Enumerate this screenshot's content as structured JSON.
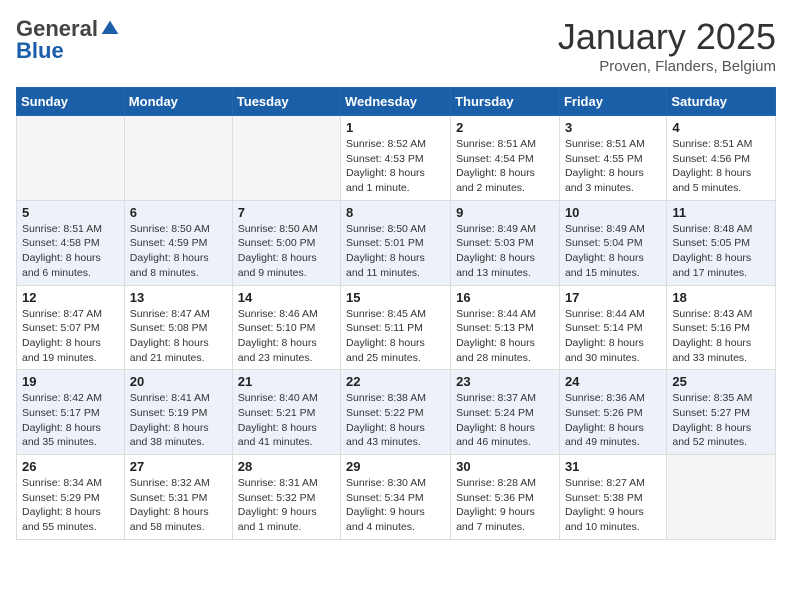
{
  "logo": {
    "general": "General",
    "blue": "Blue"
  },
  "title": {
    "month": "January 2025",
    "location": "Proven, Flanders, Belgium"
  },
  "weekdays": [
    "Sunday",
    "Monday",
    "Tuesday",
    "Wednesday",
    "Thursday",
    "Friday",
    "Saturday"
  ],
  "weeks": [
    [
      {
        "day": "",
        "content": ""
      },
      {
        "day": "",
        "content": ""
      },
      {
        "day": "",
        "content": ""
      },
      {
        "day": "1",
        "content": "Sunrise: 8:52 AM\nSunset: 4:53 PM\nDaylight: 8 hours and 1 minute."
      },
      {
        "day": "2",
        "content": "Sunrise: 8:51 AM\nSunset: 4:54 PM\nDaylight: 8 hours and 2 minutes."
      },
      {
        "day": "3",
        "content": "Sunrise: 8:51 AM\nSunset: 4:55 PM\nDaylight: 8 hours and 3 minutes."
      },
      {
        "day": "4",
        "content": "Sunrise: 8:51 AM\nSunset: 4:56 PM\nDaylight: 8 hours and 5 minutes."
      }
    ],
    [
      {
        "day": "5",
        "content": "Sunrise: 8:51 AM\nSunset: 4:58 PM\nDaylight: 8 hours and 6 minutes."
      },
      {
        "day": "6",
        "content": "Sunrise: 8:50 AM\nSunset: 4:59 PM\nDaylight: 8 hours and 8 minutes."
      },
      {
        "day": "7",
        "content": "Sunrise: 8:50 AM\nSunset: 5:00 PM\nDaylight: 8 hours and 9 minutes."
      },
      {
        "day": "8",
        "content": "Sunrise: 8:50 AM\nSunset: 5:01 PM\nDaylight: 8 hours and 11 minutes."
      },
      {
        "day": "9",
        "content": "Sunrise: 8:49 AM\nSunset: 5:03 PM\nDaylight: 8 hours and 13 minutes."
      },
      {
        "day": "10",
        "content": "Sunrise: 8:49 AM\nSunset: 5:04 PM\nDaylight: 8 hours and 15 minutes."
      },
      {
        "day": "11",
        "content": "Sunrise: 8:48 AM\nSunset: 5:05 PM\nDaylight: 8 hours and 17 minutes."
      }
    ],
    [
      {
        "day": "12",
        "content": "Sunrise: 8:47 AM\nSunset: 5:07 PM\nDaylight: 8 hours and 19 minutes."
      },
      {
        "day": "13",
        "content": "Sunrise: 8:47 AM\nSunset: 5:08 PM\nDaylight: 8 hours and 21 minutes."
      },
      {
        "day": "14",
        "content": "Sunrise: 8:46 AM\nSunset: 5:10 PM\nDaylight: 8 hours and 23 minutes."
      },
      {
        "day": "15",
        "content": "Sunrise: 8:45 AM\nSunset: 5:11 PM\nDaylight: 8 hours and 25 minutes."
      },
      {
        "day": "16",
        "content": "Sunrise: 8:44 AM\nSunset: 5:13 PM\nDaylight: 8 hours and 28 minutes."
      },
      {
        "day": "17",
        "content": "Sunrise: 8:44 AM\nSunset: 5:14 PM\nDaylight: 8 hours and 30 minutes."
      },
      {
        "day": "18",
        "content": "Sunrise: 8:43 AM\nSunset: 5:16 PM\nDaylight: 8 hours and 33 minutes."
      }
    ],
    [
      {
        "day": "19",
        "content": "Sunrise: 8:42 AM\nSunset: 5:17 PM\nDaylight: 8 hours and 35 minutes."
      },
      {
        "day": "20",
        "content": "Sunrise: 8:41 AM\nSunset: 5:19 PM\nDaylight: 8 hours and 38 minutes."
      },
      {
        "day": "21",
        "content": "Sunrise: 8:40 AM\nSunset: 5:21 PM\nDaylight: 8 hours and 41 minutes."
      },
      {
        "day": "22",
        "content": "Sunrise: 8:38 AM\nSunset: 5:22 PM\nDaylight: 8 hours and 43 minutes."
      },
      {
        "day": "23",
        "content": "Sunrise: 8:37 AM\nSunset: 5:24 PM\nDaylight: 8 hours and 46 minutes."
      },
      {
        "day": "24",
        "content": "Sunrise: 8:36 AM\nSunset: 5:26 PM\nDaylight: 8 hours and 49 minutes."
      },
      {
        "day": "25",
        "content": "Sunrise: 8:35 AM\nSunset: 5:27 PM\nDaylight: 8 hours and 52 minutes."
      }
    ],
    [
      {
        "day": "26",
        "content": "Sunrise: 8:34 AM\nSunset: 5:29 PM\nDaylight: 8 hours and 55 minutes."
      },
      {
        "day": "27",
        "content": "Sunrise: 8:32 AM\nSunset: 5:31 PM\nDaylight: 8 hours and 58 minutes."
      },
      {
        "day": "28",
        "content": "Sunrise: 8:31 AM\nSunset: 5:32 PM\nDaylight: 9 hours and 1 minute."
      },
      {
        "day": "29",
        "content": "Sunrise: 8:30 AM\nSunset: 5:34 PM\nDaylight: 9 hours and 4 minutes."
      },
      {
        "day": "30",
        "content": "Sunrise: 8:28 AM\nSunset: 5:36 PM\nDaylight: 9 hours and 7 minutes."
      },
      {
        "day": "31",
        "content": "Sunrise: 8:27 AM\nSunset: 5:38 PM\nDaylight: 9 hours and 10 minutes."
      },
      {
        "day": "",
        "content": ""
      }
    ]
  ]
}
